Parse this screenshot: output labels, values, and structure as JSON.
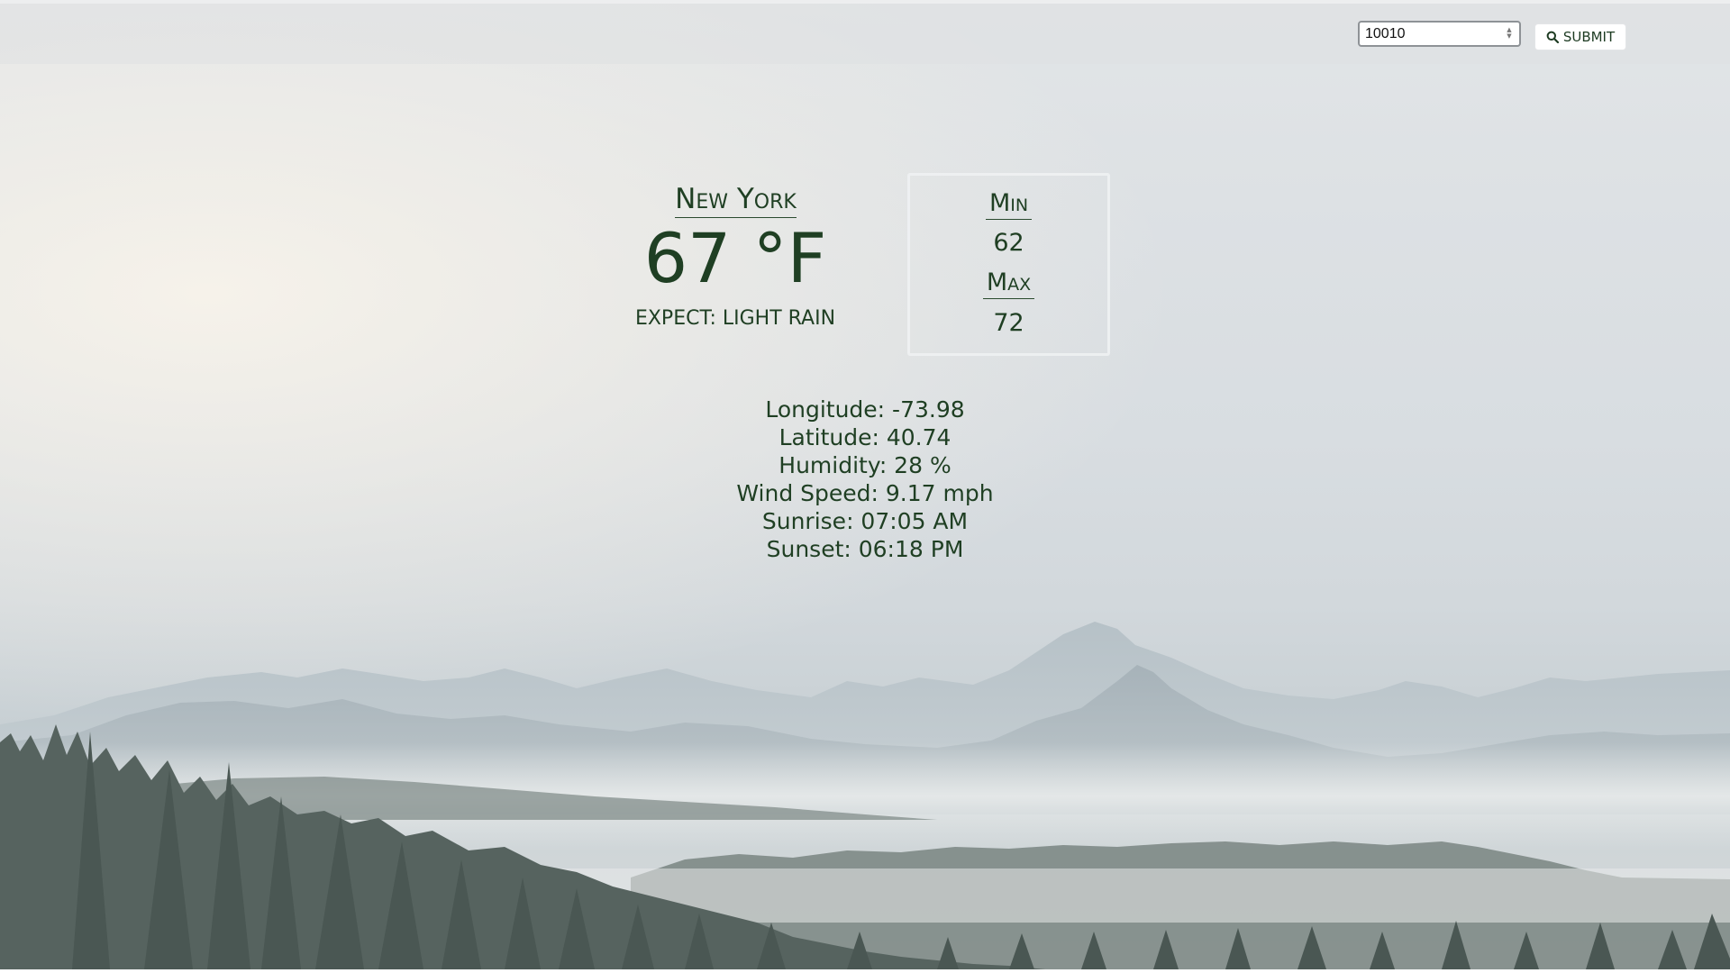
{
  "search": {
    "zip_value": "10010",
    "submit_label": "SUBMIT",
    "submit_icon": "search-icon"
  },
  "weather": {
    "city": "New York",
    "temperature": "67 °F",
    "expect": "EXPECT: LIGHT RAIN",
    "min_label": "Min",
    "min_value": "62",
    "max_label": "Max",
    "max_value": "72"
  },
  "details": {
    "longitude": "Longitude: -73.98",
    "latitude": "Latitude: 40.74",
    "humidity": "Humidity: 28 %",
    "wind_speed": "Wind Speed: 9.17 mph",
    "sunrise": "Sunrise: 07:05 AM",
    "sunset": "Sunset: 06:18 PM"
  },
  "colors": {
    "text": "#1f3f23",
    "topbar": "#dedfe1",
    "sky": "#dde1e4",
    "mountains": "#a9b6bd",
    "trees": "#4e5c57"
  },
  "background": {
    "description_icon": "misty-mountain-forest-landscape"
  }
}
